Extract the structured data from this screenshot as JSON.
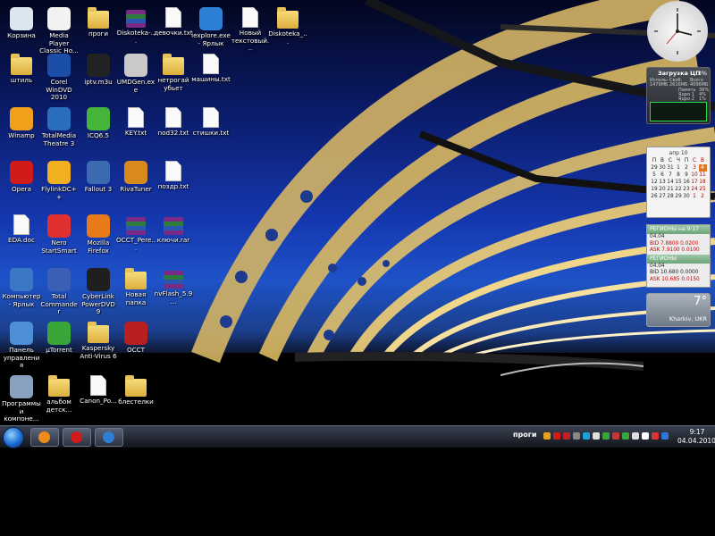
{
  "desktop_icons": [
    {
      "label": "Корзина",
      "kind": "gen",
      "color": "#dbe6ef"
    },
    {
      "label": "Media Player Classic Ho...",
      "kind": "gen",
      "color": "#f2f2f2"
    },
    {
      "label": "проги",
      "kind": "folder"
    },
    {
      "label": "Diskoteka-...",
      "kind": "rar"
    },
    {
      "label": "девочки.txt",
      "kind": "doc"
    },
    {
      "label": "iexplore.exe - Ярлык",
      "kind": "gen",
      "color": "#2d7fd6"
    },
    {
      "label": "Новый текстовый...",
      "kind": "doc"
    },
    {
      "label": "Diskoteka_...",
      "kind": "folder"
    },
    {
      "label": "штиль",
      "kind": "folder"
    },
    {
      "label": "Corel WinDVD 2010",
      "kind": "gen",
      "color": "#1b4ea8"
    },
    {
      "label": "iptv.m3u",
      "kind": "gen",
      "color": "#222"
    },
    {
      "label": "UMDGen.exe",
      "kind": "gen",
      "color": "#c9c9c9"
    },
    {
      "label": "нетрогай убьет",
      "kind": "folder"
    },
    {
      "label": "машины.txt",
      "kind": "doc"
    },
    {
      "label": "Winamp",
      "kind": "gen",
      "color": "#f0a01a"
    },
    {
      "label": "TotalMedia Theatre 3",
      "kind": "gen",
      "color": "#2a6fbd"
    },
    {
      "label": "ICQ6.5",
      "kind": "gen",
      "color": "#44b53a"
    },
    {
      "label": "KEY.txt",
      "kind": "doc"
    },
    {
      "label": "nod32.txt",
      "kind": "doc"
    },
    {
      "label": "стишки.txt",
      "kind": "doc"
    },
    {
      "label": "Opera",
      "kind": "gen",
      "color": "#d11a1a"
    },
    {
      "label": "FlylinkDC++",
      "kind": "gen",
      "color": "#f1b020"
    },
    {
      "label": "Fallout 3",
      "kind": "gen",
      "color": "#3b6ab0"
    },
    {
      "label": "RivaTuner",
      "kind": "gen",
      "color": "#d88b1c"
    },
    {
      "label": "поздр.txt",
      "kind": "doc"
    },
    {
      "label": "EDA.doc",
      "kind": "doc"
    },
    {
      "label": "Nero StartSmart",
      "kind": "gen",
      "color": "#e03030"
    },
    {
      "label": "Mozilla Firefox",
      "kind": "gen",
      "color": "#e87a1a"
    },
    {
      "label": "OCCT_Pere...",
      "kind": "rar"
    },
    {
      "label": "ключи.rar",
      "kind": "rar"
    },
    {
      "label": "Компьютер - Ярлык",
      "kind": "gen",
      "color": "#3a78c6"
    },
    {
      "label": "Total Commander",
      "kind": "gen",
      "color": "#3c5fb6"
    },
    {
      "label": "CyberLink PowerDVD 9",
      "kind": "gen",
      "color": "#1f1f1f"
    },
    {
      "label": "Новая папка",
      "kind": "folder"
    },
    {
      "label": "nvFlash_5.9...",
      "kind": "rar"
    },
    {
      "label": "Панель управления",
      "kind": "gen",
      "color": "#4f8fd6"
    },
    {
      "label": "µTorrent",
      "kind": "gen",
      "color": "#3aa63a"
    },
    {
      "label": "Kaspersky Anti-Virus 6",
      "kind": "folder"
    },
    {
      "label": "OCCT",
      "kind": "gen",
      "color": "#b81f1f"
    },
    {
      "label": "Программы и компоне...",
      "kind": "gen",
      "color": "#8aa0bf"
    },
    {
      "label": "альбом детск...",
      "kind": "folder"
    },
    {
      "label": "Canon_Po...",
      "kind": "doc"
    },
    {
      "label": "блестелки",
      "kind": "folder"
    }
  ],
  "taskbar": {
    "buttons": [
      {
        "name": "mail-agent",
        "color": "#f08a1a"
      },
      {
        "name": "opera",
        "color": "#d11a1a"
      },
      {
        "name": "ie",
        "color": "#2d7fd6"
      }
    ],
    "tray_label": "проги",
    "time": "9:17",
    "date": "04.04.2010"
  },
  "gadgets": {
    "cpu": {
      "title": "Загрузка ЦП",
      "percent": "3%",
      "stats": [
        "Исполь-",
        "Своб.",
        "Всего",
        "1479МБ",
        "2616МБ",
        "4096МБ"
      ],
      "rows": [
        {
          "label": "Память",
          "value": "36%"
        },
        {
          "label": "Ядро 1",
          "value": "4%"
        },
        {
          "label": "Ядро 2",
          "value": "1%"
        }
      ]
    },
    "calendar": {
      "header": "апр 10",
      "days": [
        "П",
        "В",
        "С",
        "Ч",
        "П",
        "С",
        "В"
      ],
      "weeks": [
        [
          "29",
          "30",
          "31",
          "1",
          "2",
          "3",
          "4"
        ],
        [
          "5",
          "6",
          "7",
          "8",
          "9",
          "10",
          "11"
        ],
        [
          "12",
          "13",
          "14",
          "15",
          "16",
          "17",
          "18"
        ],
        [
          "19",
          "20",
          "21",
          "22",
          "23",
          "24",
          "25"
        ],
        [
          "26",
          "27",
          "28",
          "29",
          "30",
          "1",
          "2"
        ]
      ]
    },
    "currency": {
      "head1": "РЕГИОНЫ",
      "head1_time": "на 9:17",
      "date1": "04.04",
      "bid1": "BID 7.8800 0.0200",
      "ask1": "ASK 7.9100 0.0100",
      "head2": "РЕГИОНЫ",
      "date2": "04.04",
      "bid2": "BID 10.680 0.0000",
      "ask2": "ASK 10.685 0.0150"
    },
    "weather": {
      "temp": "7°",
      "city": "Kharkiv, UKR"
    }
  },
  "colors": {
    "taskbar": "#1c212a",
    "sky": "#1e52c8"
  }
}
